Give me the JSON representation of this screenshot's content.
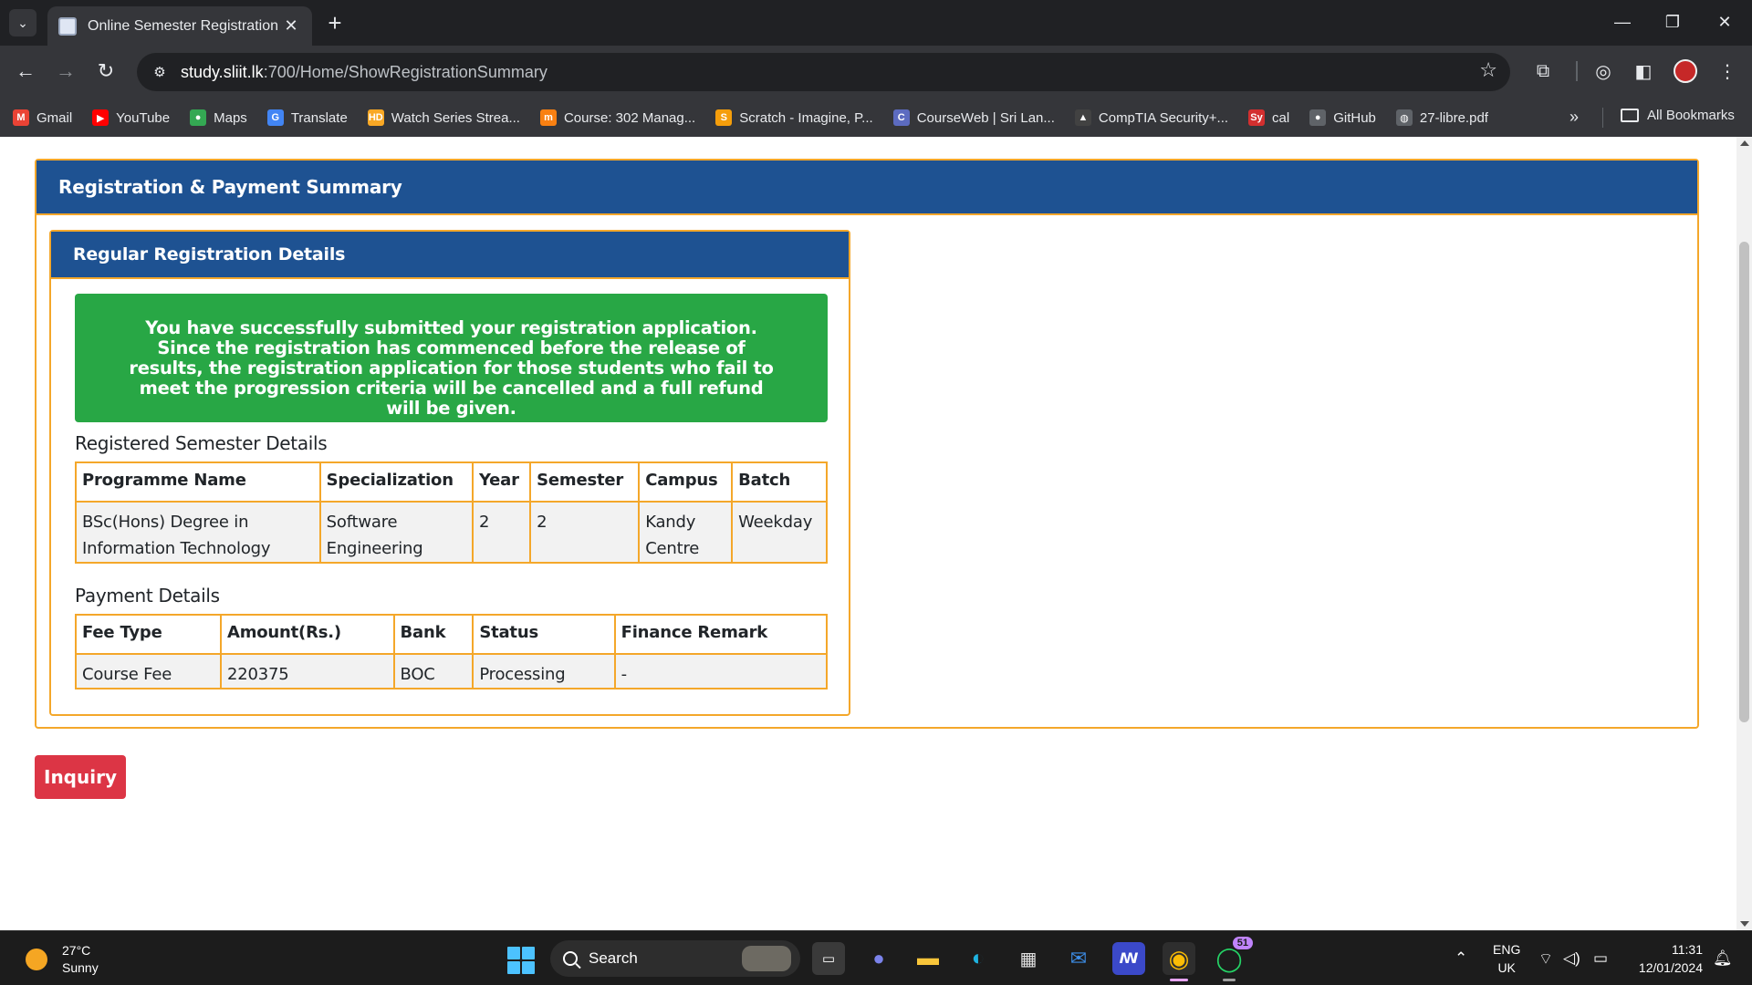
{
  "browser": {
    "tab_title": "Online Semester Registration",
    "url_host": "study.sliit.lk",
    "url_path": ":700/Home/ShowRegistrationSummary",
    "bookmarks": [
      {
        "label": "Gmail",
        "icon": "gmail-icon",
        "color": "#ea4335",
        "glyph": "M"
      },
      {
        "label": "YouTube",
        "icon": "youtube-icon",
        "color": "#ff0000",
        "glyph": "▶"
      },
      {
        "label": "Maps",
        "icon": "maps-icon",
        "color": "#34a853",
        "glyph": "●"
      },
      {
        "label": "Translate",
        "icon": "translate-icon",
        "color": "#4285f4",
        "glyph": "G"
      },
      {
        "label": "Watch Series Strea...",
        "icon": "hd-icon",
        "color": "#f9a825",
        "glyph": "HD"
      },
      {
        "label": "Course: 302 Manag...",
        "icon": "moodle-icon",
        "color": "#f98012",
        "glyph": "m"
      },
      {
        "label": "Scratch - Imagine, P...",
        "icon": "scratch-icon",
        "color": "#f59e0b",
        "glyph": "S"
      },
      {
        "label": "CourseWeb | Sri Lan...",
        "icon": "courseweb-icon",
        "color": "#5c6bc0",
        "glyph": "C"
      },
      {
        "label": "CompTIA Security+...",
        "icon": "comptia-icon",
        "color": "#424242",
        "glyph": "▲"
      },
      {
        "label": "cal",
        "icon": "sy-icon",
        "color": "#d32f2f",
        "glyph": "Sy"
      },
      {
        "label": "GitHub",
        "icon": "github-icon",
        "color": "#5f6368",
        "glyph": "●"
      },
      {
        "label": "27-libre.pdf",
        "icon": "globe-icon",
        "color": "#5f6368",
        "glyph": "◍"
      }
    ],
    "all_bookmarks": "All Bookmarks"
  },
  "page": {
    "outer_title": "Registration & Payment Summary",
    "inner_title": "Regular Registration Details",
    "alert_text": "You have successfully submitted your registration application. Since the registration has commenced before the release of results, the registration application for those students who fail to meet the progression criteria will be cancelled and a full refund will be given.",
    "semester_section_title": "Registered Semester Details",
    "semester_table": {
      "headers": [
        "Programme Name",
        "Specialization",
        "Year",
        "Semester",
        "Campus",
        "Batch"
      ],
      "row": [
        "BSc(Hons) Degree in Information Technology",
        "Software Engineering",
        "2",
        "2",
        "Kandy Centre",
        "Weekday"
      ]
    },
    "payment_section_title": "Payment Details",
    "payment_table": {
      "headers": [
        "Fee Type",
        "Amount(Rs.)",
        "Bank",
        "Status",
        "Finance Remark"
      ],
      "row": [
        "Course Fee",
        "220375",
        "BOC",
        "Processing",
        "-"
      ]
    },
    "inquiry_button": "Inquiry"
  },
  "taskbar": {
    "temperature": "27°C",
    "weather": "Sunny",
    "search_label": "Search",
    "whatsapp_badge": "51",
    "language": "ENG",
    "region": "UK",
    "time": "11:31",
    "date": "12/01/2024"
  },
  "colors": {
    "panel_header": "#1e5292",
    "panel_border": "#f4a72a",
    "alert_success": "#28a745",
    "inquiry_button": "#dc3545"
  }
}
